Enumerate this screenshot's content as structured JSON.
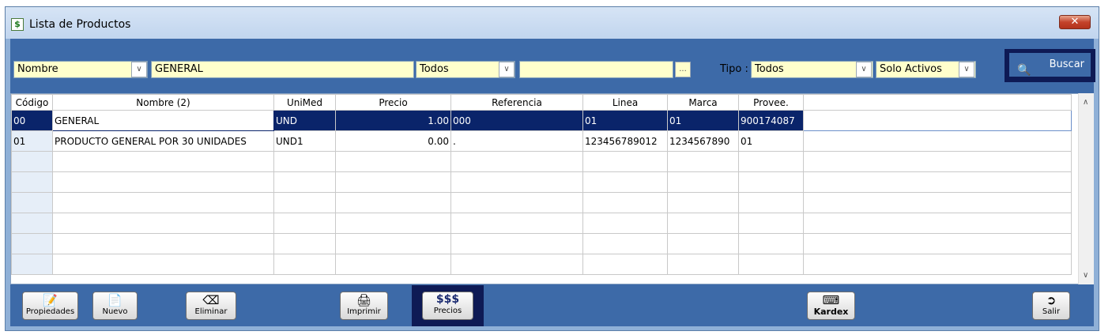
{
  "window": {
    "title": "Lista de Productos",
    "close_label": "✕"
  },
  "filters": {
    "field_select": "Nombre",
    "search_text": "GENERAL",
    "scope_select": "Todos",
    "scope_text": "",
    "browse_label": "...",
    "tipo_label": "Tipo :",
    "tipo_select": "Todos",
    "status_select": "Solo Activos",
    "search_button": "Buscar"
  },
  "grid": {
    "columns": [
      "Código",
      "Nombre (2)",
      "UniMed",
      "Precio",
      "Referencia",
      "Linea",
      "Marca",
      "Provee."
    ],
    "rows": [
      [
        "00",
        "GENERAL",
        "UND",
        "1.00",
        "000",
        "01",
        "01",
        "900174087"
      ],
      [
        "01",
        "PRODUCTO GENERAL POR 30 UNIDADES",
        "UND1",
        "0.00",
        ".",
        "123456789012",
        "1234567890",
        "01"
      ]
    ]
  },
  "toolbar": {
    "propiedades": "Propiedades",
    "nuevo": "Nuevo",
    "eliminar": "Eliminar",
    "imprimir": "Imprimir",
    "precios_icon_text": "$$$",
    "precios": "Precios",
    "kardex": "Kardex",
    "salir": "Salir"
  },
  "colors": {
    "frame_blue": "#3d6aa8",
    "highlight_navy": "#0e1a55",
    "selected_row": "#0a246a",
    "field_yellow": "#ffffcc"
  }
}
